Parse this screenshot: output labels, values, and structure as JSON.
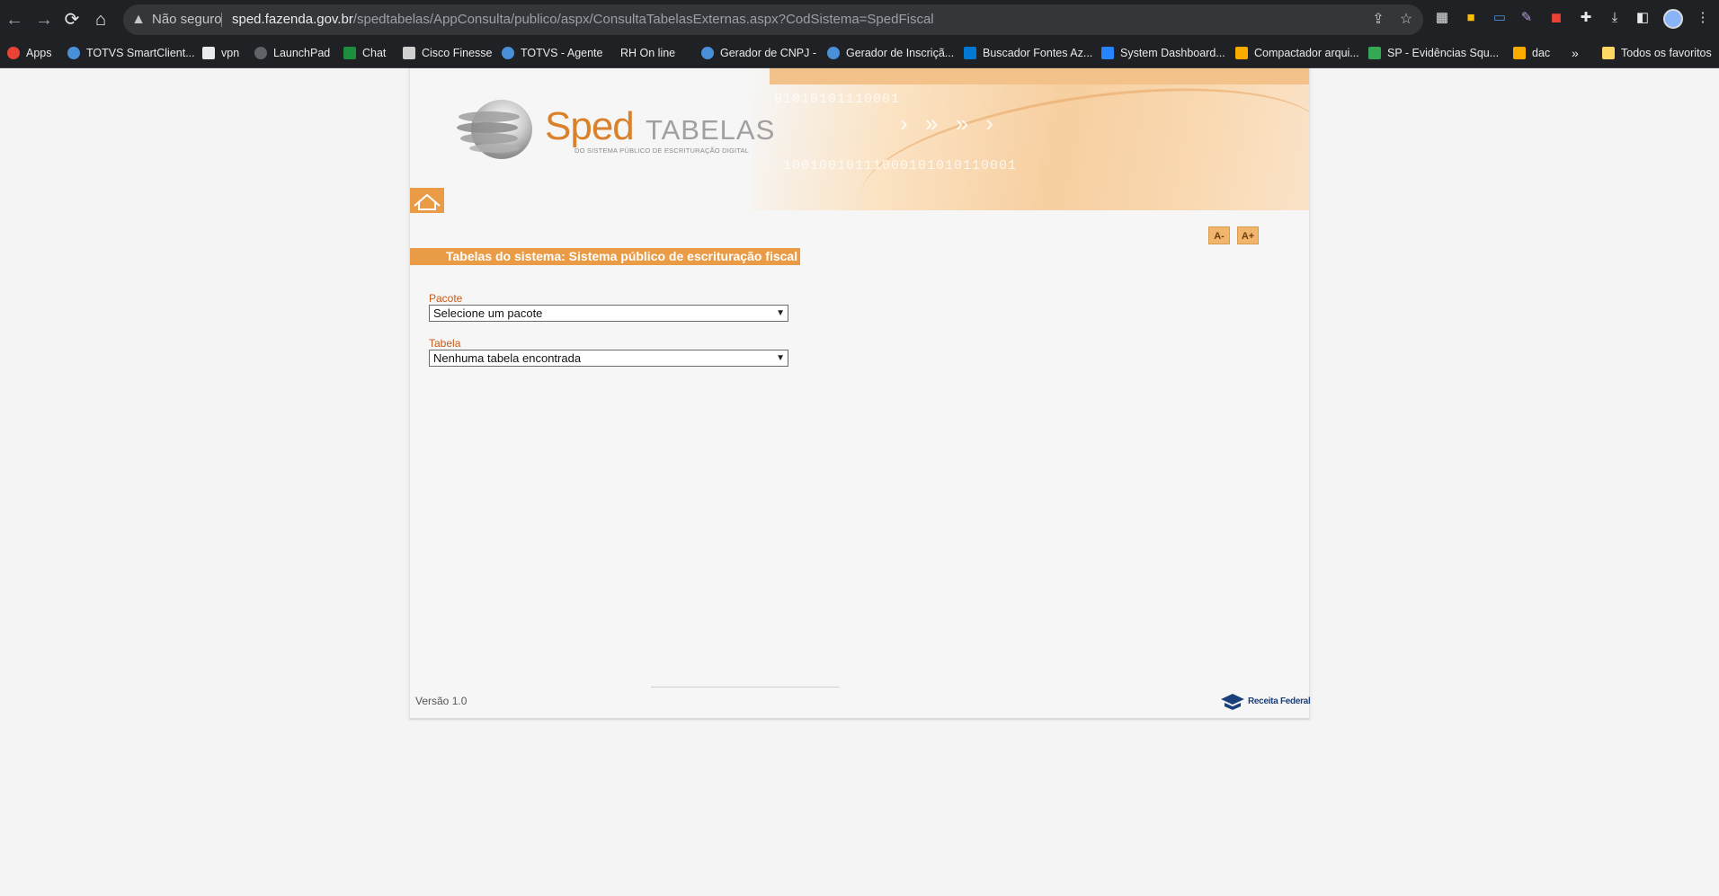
{
  "browser": {
    "security_label": "Não seguro",
    "url_host": "sped.fazenda.gov.br",
    "url_path": "/spedtabelas/AppConsulta/publico/aspx/ConsultaTabelasExternas.aspx?CodSistema=SpedFiscal"
  },
  "bookmarks": [
    {
      "label": "Apps",
      "icon": "apps-grid-icon",
      "color": "#ea4335"
    },
    {
      "label": "TOTVS SmartClient...",
      "icon": "totvs-icon",
      "color": "#4a90d9"
    },
    {
      "label": "vpn",
      "icon": "page-icon",
      "color": "#e8eaed"
    },
    {
      "label": "LaunchPad",
      "icon": "launchpad-icon",
      "color": "#5f6368"
    },
    {
      "label": "Chat",
      "icon": "chat-icon",
      "color": "#1e8e3e"
    },
    {
      "label": "Cisco Finesse",
      "icon": "cisco-icon",
      "color": "#d0d0d0"
    },
    {
      "label": "TOTVS - Agente",
      "icon": "totvs-icon",
      "color": "#4a90d9"
    },
    {
      "label": "RH On line",
      "icon": "",
      "color": ""
    },
    {
      "label": "Gerador de CNPJ -",
      "icon": "generator-icon",
      "color": "#4a90d9"
    },
    {
      "label": "Gerador de Inscriçã...",
      "icon": "generator-icon",
      "color": "#4a90d9"
    },
    {
      "label": "Buscador Fontes Az...",
      "icon": "azure-icon",
      "color": "#0078d4"
    },
    {
      "label": "System Dashboard...",
      "icon": "jira-icon",
      "color": "#2684ff"
    },
    {
      "label": "Compactador arqui...",
      "icon": "compress-icon",
      "color": "#f9ab00"
    },
    {
      "label": "SP - Evidências Squ...",
      "icon": "drive-icon",
      "color": "#34a853"
    },
    {
      "label": "dac",
      "icon": "dac-icon",
      "color": "#f9ab00"
    }
  ],
  "bookmarks_more": "»",
  "all_bookmarks": "Todos os favoritos",
  "page": {
    "logo_sped": "Sped",
    "logo_tabelas": "TABELAS",
    "logo_subtitle": "DO SISTEMA PÚBLICO DE ESCRITURAÇÃO DIGITAL",
    "banner_binary_1": "01010101110001",
    "banner_binary_2": "10010010111000101010110001",
    "font_decrease": "A-",
    "font_increase": "A+",
    "section_title": "Tabelas do sistema: Sistema público de escrituração fiscal",
    "pacote_label": "Pacote",
    "pacote_value": "Selecione um pacote",
    "tabela_label": "Tabela",
    "tabela_value": "Nenhuma tabela encontrada",
    "version": "Versão 1.0",
    "rf_logo_text": "Receita Federal"
  },
  "colors": {
    "accent_orange": "#e99b45",
    "label_orange": "#c65a16",
    "logo_orange": "#d9822b"
  }
}
